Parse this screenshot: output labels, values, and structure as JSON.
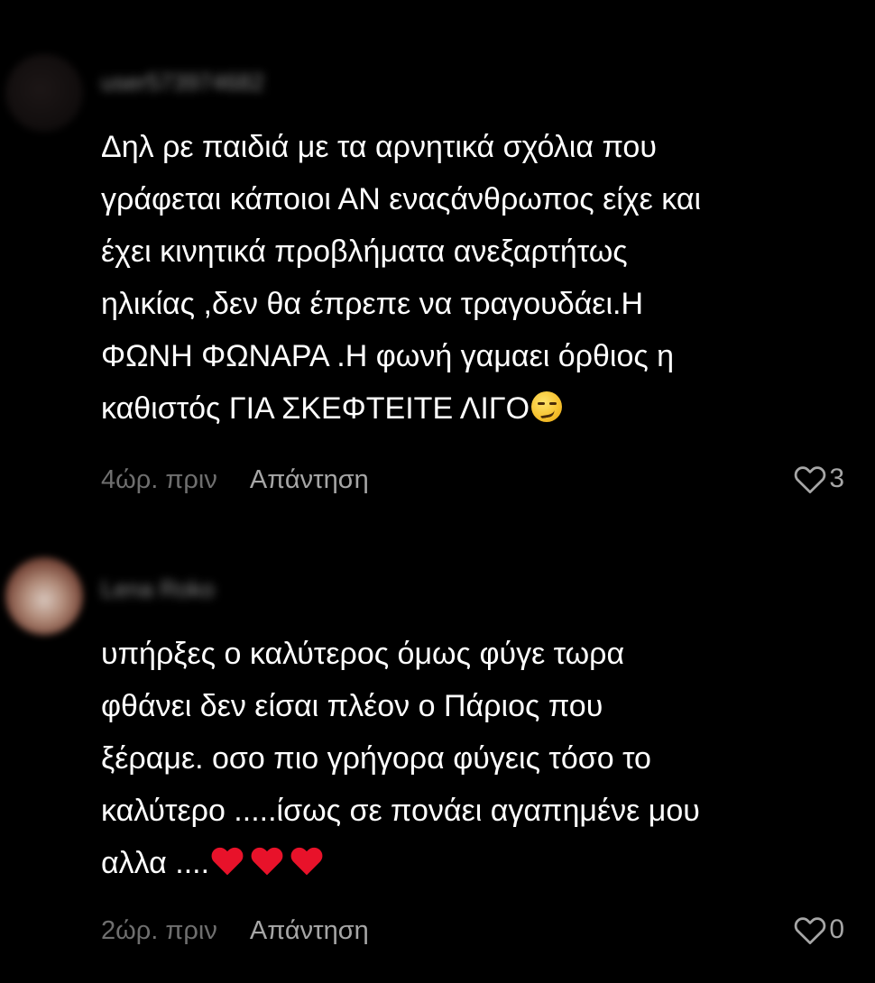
{
  "colors": {
    "background": "#000000",
    "text": "#ffffff",
    "muted": "#6f6f6f",
    "reply": "#a6a6a6"
  },
  "comments": [
    {
      "username": "user573974682",
      "text": "Δηλ ρε παιδιά με τα αρνητικά σχόλια που\nγράφεται κάποιοι ΑΝ εναςάνθρωπος είχε και\nέχει κινητικά προβλήματα ανεξαρτήτως\nηλικίας ,δεν θα έπρεπε να τραγουδάει.Η\nΦΩΝΗ ΦΩΝΑΡΑ .Η φωνή γαμαει όρθιος η\nκαθιστός ΓΙΑ ΣΚΕΦΤΕΙΤΕ ΛΙΓΟ",
      "emoji": "smirking-face",
      "time": "4ώρ. πριν",
      "reply_label": "Απάντηση",
      "likes": "3"
    },
    {
      "username": "Lena Roko",
      "text": "υπήρξες ο καλύτερος όμως φύγε τωρα\nφθάνει δεν είσαι πλέον ο Πάριος που\nξέραμε. οσο πιο γρήγορα φύγεις τόσο το\nκαλύτερο .....ίσως σε πονάει αγαπημένε μου\nαλλα ....",
      "emoji": "red-heart x3",
      "time": "2ώρ. πριν",
      "reply_label": "Απάντηση",
      "likes": "0"
    }
  ]
}
